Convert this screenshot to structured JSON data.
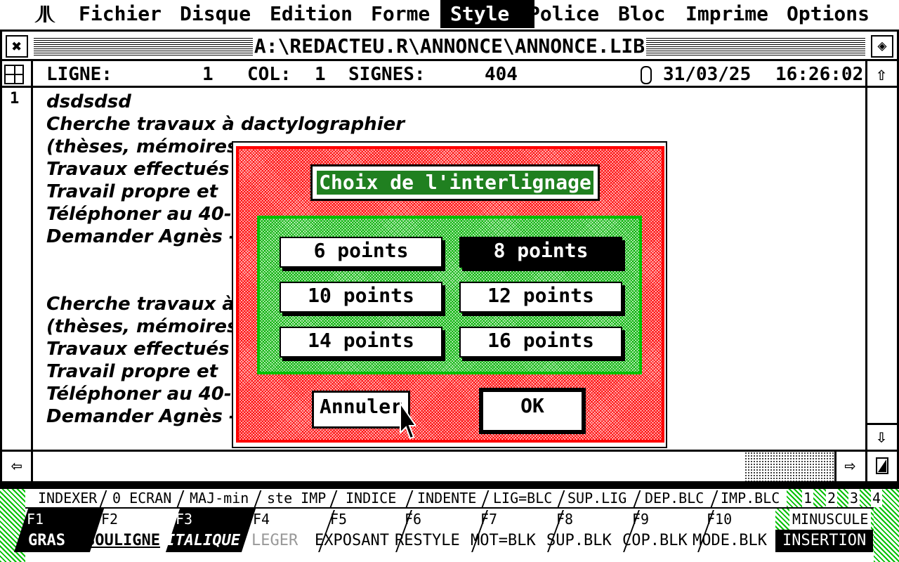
{
  "menubar": {
    "logo_icon": "atari-fuji-icon",
    "items": [
      "Fichier",
      "Disque",
      "Edition",
      "Forme",
      "Style",
      "Police",
      "Bloc",
      "Imprime",
      "Options"
    ],
    "active": "Style"
  },
  "window": {
    "title": "A:\\REDACTEU.R\\ANNONCE\\ANNONCE.LIB",
    "close_icon": "close-box-icon",
    "fuller_icon": "fuller-icon",
    "status": {
      "ligne_label": "LIGNE:",
      "ligne_value": "1",
      "col_label": "COL:",
      "col_value": "1",
      "signes_label": "SIGNES:",
      "signes_value": "404",
      "clock_icon": "clock-icon",
      "date": "31/03/25",
      "time": "16:26:02"
    },
    "line_number": "1"
  },
  "document": {
    "lines": [
      "dsdsdsd",
      "Cherche travaux à dactylographier",
      "(thèses, mémoires",
      "Travaux effectués",
      "Travail propre et",
      "Téléphoner au 40-",
      "Demander Agnès -",
      "",
      "",
      "Cherche travaux à",
      "(thèses, mémoires",
      "Travaux effectués",
      "Travail propre et",
      "Téléphoner au 40-",
      "Demander Agnès -"
    ]
  },
  "dialog": {
    "title": "Choix de l'interlignage",
    "options": [
      "6 points",
      "8 points",
      "10 points",
      "12 points",
      "14 points",
      "16 points"
    ],
    "selected_option": "8 points",
    "cancel_label": "Annuler",
    "ok_label": "OK"
  },
  "fkeys": {
    "shift_row": [
      "INDEXER",
      "0 ECRAN",
      "MAJ-min",
      "ste IMP",
      "INDICE",
      "INDENTE",
      "LIG=BLC",
      "SUP.LIG",
      "DEP.BLC",
      "IMP.BLC"
    ],
    "keys": [
      {
        "num": "F1",
        "label": "GRAS"
      },
      {
        "num": "F2",
        "label": "SOULIGNE"
      },
      {
        "num": "F3",
        "label": "ITALIQUE"
      },
      {
        "num": "F4",
        "label": "LEGER"
      },
      {
        "num": "F5",
        "label": "EXPOSANT"
      },
      {
        "num": "F6",
        "label": "RESTYLE"
      },
      {
        "num": "F7",
        "label": "MOT=BLK"
      },
      {
        "num": "F8",
        "label": "SUP.BLK"
      },
      {
        "num": "F9",
        "label": "COP.BLK"
      },
      {
        "num": "F10",
        "label": "MODE.BLK"
      }
    ],
    "pages": [
      "1",
      "2",
      "3",
      "4"
    ],
    "mode_case": "MINUSCULE",
    "mode_insert": "INSERTION"
  }
}
